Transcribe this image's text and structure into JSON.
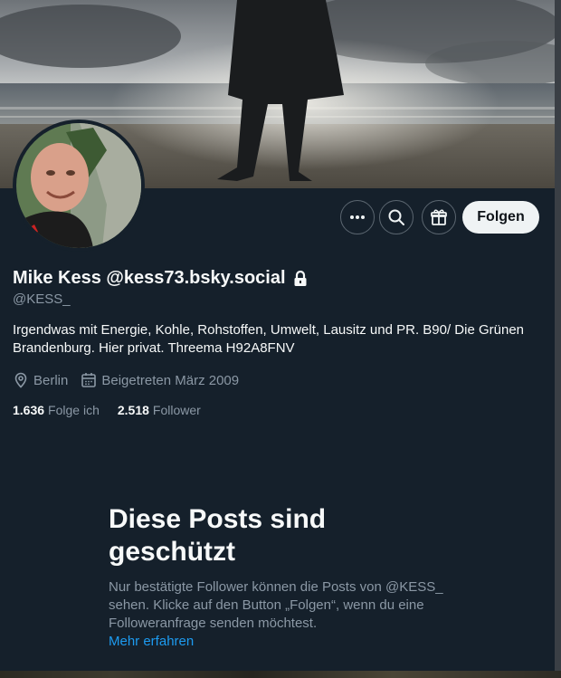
{
  "profile": {
    "name": "Mike Kess @kess73.bsky.social",
    "handle": "@KESS_",
    "bio": "Irgendwas mit Energie, Kohle, Rohstoffen, Umwelt, Lausitz und PR. B90/ Die Grünen Brandenburg. Hier privat. Threema H92A8FNV",
    "location": "Berlin",
    "joined": "Beigetreten März 2009"
  },
  "actions": {
    "follow_label": "Folgen"
  },
  "stats": {
    "following_count": "1.636",
    "following_label": "Folge ich",
    "followers_count": "2.518",
    "followers_label": "Follower"
  },
  "protected": {
    "title": "Diese Posts sind geschützt",
    "text": "Nur bestätigte Follower können die Posts von @KESS_ sehen. Klicke auf den Button „Folgen“, wenn du eine Followeranfrage senden möchtest.",
    "link": "Mehr erfahren"
  },
  "icons": {
    "more": "more-icon",
    "search": "search-icon",
    "subscribe": "gift-icon",
    "lock": "lock-icon",
    "location": "location-icon",
    "calendar": "calendar-icon"
  },
  "colors": {
    "background": "#15202b",
    "accent": "#1d9bf0",
    "muted": "#8b98a5",
    "follow_button": "#eff3f4"
  }
}
